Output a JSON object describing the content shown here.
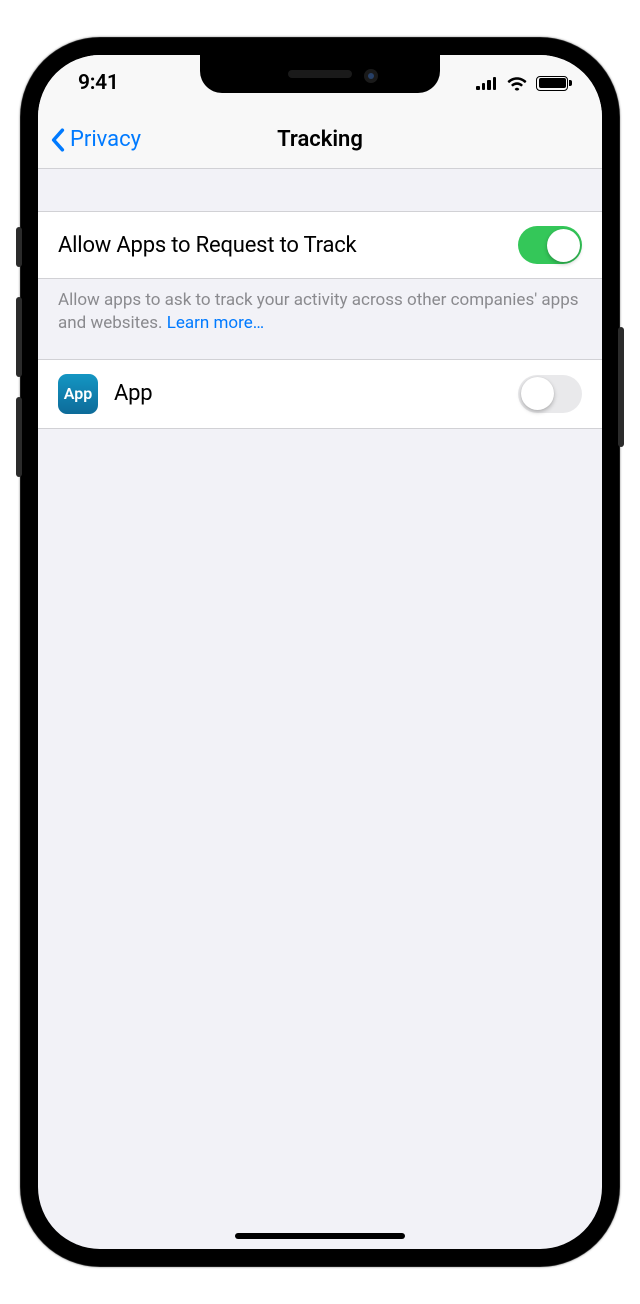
{
  "status_bar": {
    "time": "9:41"
  },
  "nav": {
    "back_label": "Privacy",
    "title": "Tracking"
  },
  "settings": {
    "allow_request": {
      "label": "Allow Apps to Request to Track",
      "enabled": true,
      "description": "Allow apps to ask to track your activity across other companies' apps and websites. ",
      "learn_more": "Learn more…"
    },
    "apps": [
      {
        "icon_label": "App",
        "name": "App",
        "enabled": false
      }
    ]
  }
}
